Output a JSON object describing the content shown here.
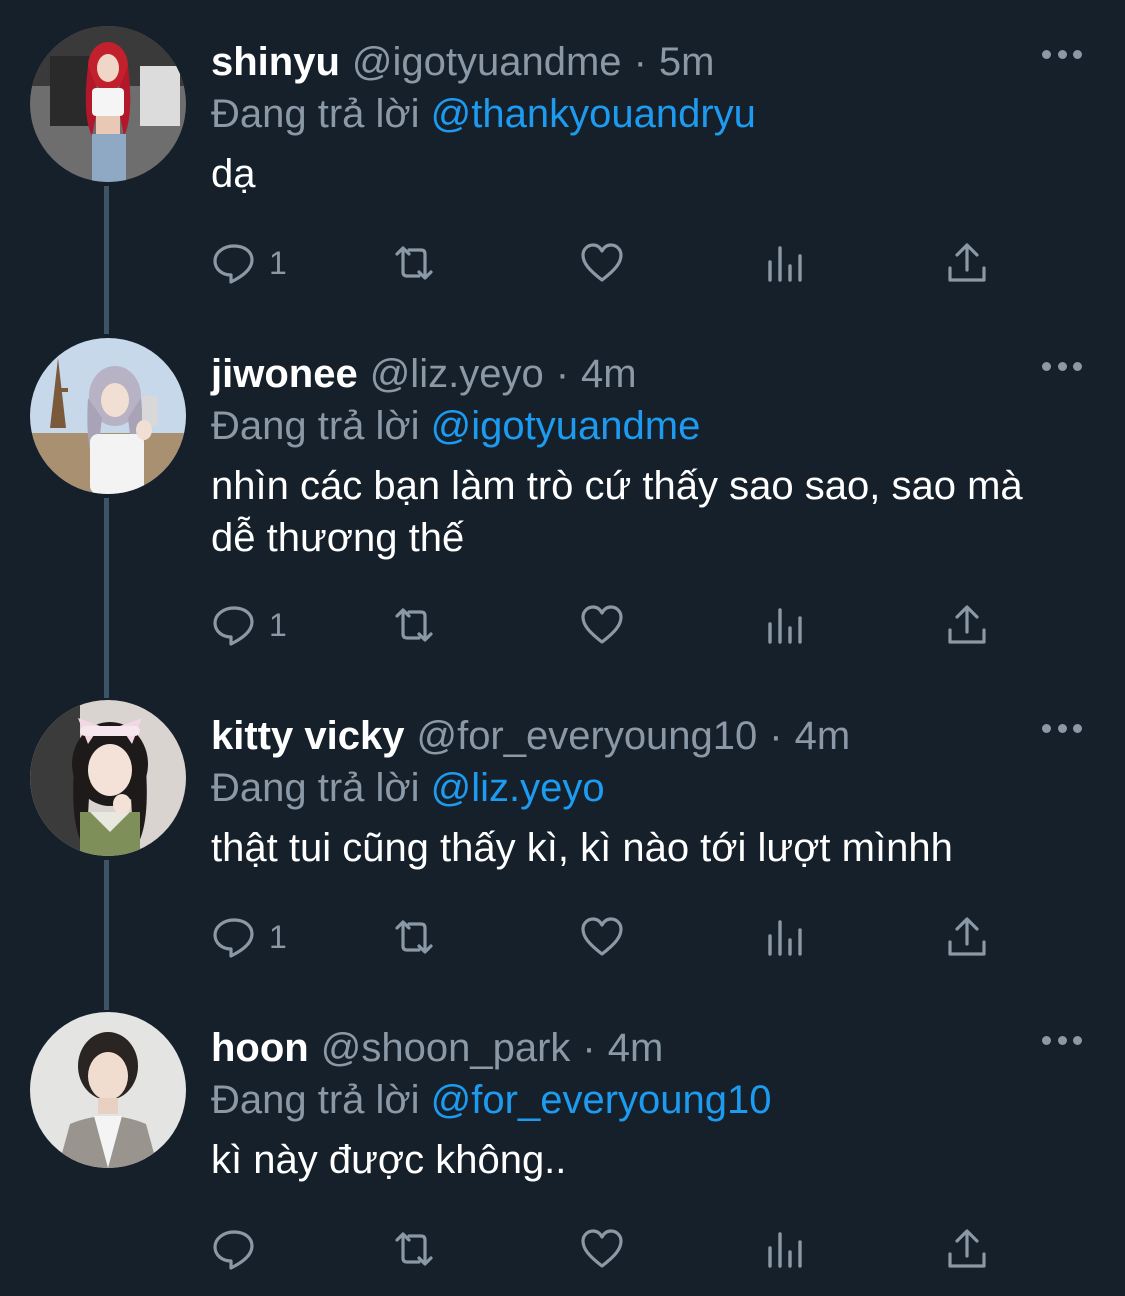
{
  "reply_prefix": "Đang trả lời",
  "colors": {
    "background": "#15202b",
    "text_primary": "#ffffff",
    "text_secondary": "#8b98a5",
    "link": "#1d9bf0",
    "thread_line": "#3d5466"
  },
  "tweets": [
    {
      "name": "shinyu",
      "handle": "@igotyuandme",
      "separator": "·",
      "time": "5m",
      "reply_to": "@thankyouandryu",
      "text": "dạ",
      "reply_count": "1"
    },
    {
      "name": "jiwonee",
      "handle": "@liz.yeyo",
      "separator": "·",
      "time": "4m",
      "reply_to": "@igotyuandme",
      "text": "nhìn các bạn làm trò cứ thấy sao sao, sao mà dễ thương thế",
      "reply_count": "1"
    },
    {
      "name": "kitty vicky",
      "handle": "@for_everyoung10",
      "separator": "·",
      "time": "4m",
      "reply_to": "@liz.yeyo",
      "text": "thật tui cũng thấy kì, kì nào tới lượt mìnhh",
      "reply_count": "1"
    },
    {
      "name": "hoon",
      "handle": "@shoon_park",
      "separator": "·",
      "time": "4m",
      "reply_to": "@for_everyoung10",
      "text": "kì này được không..",
      "reply_count": ""
    }
  ],
  "icons": {
    "reply": "comment-bubble-icon",
    "retweet": "retweet-icon",
    "like": "heart-icon",
    "views": "analytics-bars-icon",
    "share": "share-upload-icon",
    "more": "more-horizontal-icon"
  }
}
